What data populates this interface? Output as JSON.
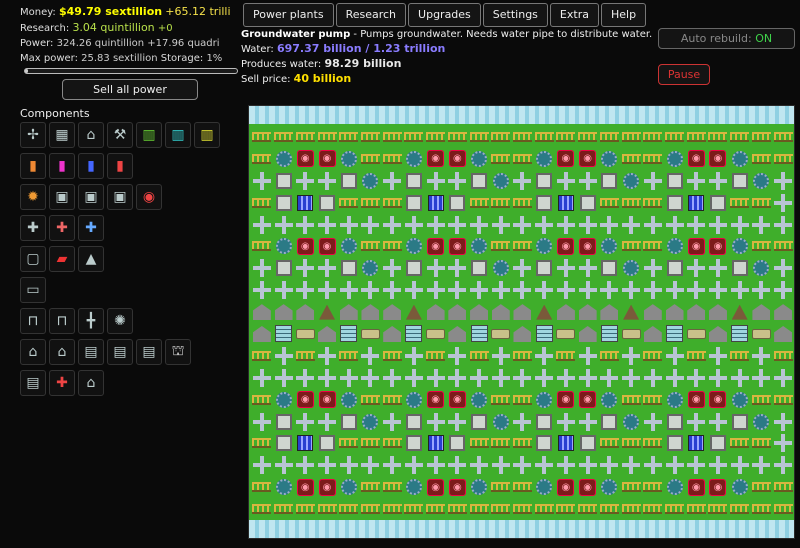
{
  "stats": {
    "money_label": "Money:",
    "money_value": "$49.79 sextillion",
    "money_rate": "+65.12 trilli",
    "research_label": "Research:",
    "research_value": "3.04 quintillion",
    "research_rate": "+0",
    "power_label": "Power:",
    "power_value": "324.26 quintillion",
    "power_rate": "+17.96 quadri",
    "maxpower_label": "Max power:",
    "maxpower_value": "25.83 sextillion",
    "storage_label": "Storage:",
    "storage_value": "1%",
    "power_fraction": 0.013
  },
  "sell_all_label": "Sell all power",
  "nav": [
    "Power plants",
    "Research",
    "Upgrades",
    "Settings",
    "Extra",
    "Help"
  ],
  "info": {
    "title": "Groundwater pump",
    "description": " - Pumps groundwater. Needs water pipe to distribute water.",
    "water_label": "Water: ",
    "water_value": "697.37 billion / 1.23 trillion",
    "produces_label": "Produces water: ",
    "produces_value": "98.29 billion",
    "sell_label": "Sell price: ",
    "sell_value": "40 billion"
  },
  "auto_rebuild_label": "Auto rebuild:",
  "auto_rebuild_value": "ON",
  "pause_label": "Pause",
  "components_title": "Components",
  "palette": [
    [
      "wind-turbine-icon",
      "solar-panel-icon",
      "coal-plant-icon",
      "oil-derrick-icon",
      "generator-green-icon",
      "generator-cyan-icon",
      "generator-yellow-icon"
    ],
    [
      "reactor-orange-icon",
      "reactor-pink-icon",
      "reactor-blue-icon",
      "reactor-red-icon"
    ],
    [
      "gear-orange-icon",
      "heat-exchanger-icon",
      "heat-exchanger-green-icon",
      "heat-exchanger-white-icon",
      "groundwater-pump-icon"
    ],
    [
      "pipe-icon",
      "pipe-red-icon",
      "pipe-blue-icon"
    ],
    [
      "tank-icon",
      "battery-icon",
      "tent-icon"
    ],
    [
      "bench-icon"
    ],
    [
      "fence-icon",
      "fence-yellow-icon",
      "cross-pipe-icon",
      "gear-icon"
    ],
    [
      "shop-icon",
      "house-icon",
      "apartment-icon",
      "office-icon",
      "office-tall-icon",
      "bank-icon"
    ],
    [
      "school-icon",
      "hospital-icon",
      "factory-icon"
    ]
  ],
  "grid_rows": [
    "FFFFFFFFFFFFFFFFFFFFFFFFF",
    "FGPPGFFGPPGFFGPPGFFGPPGFF",
    "XSXXSGXSXXSGXSXXSGXSXXSGX",
    "FSBSFFFSBSFFFSBSFFFSBSFFX",
    "XXXXXXXXXXXXXXXXXXXXXXXXX",
    "FGPPGFFGPPGFFGPPGFFGPPGFF",
    "XSXXSGXSXXSGXSXXSGXSXXSGX",
    "XXXXXXXXXXXXXXXXXXXXXXXXX",
    "HHHTHHHTHHHHHTHHHTHHHHTHH",
    "HONHONHONHONHONHONHONHONH",
    "FXFXFXFXFXFXFXFXFXFXFXFXF",
    "XXXXXXXXXXXXXXXXXXXXXXXXX",
    "FGPPGFFGPPGFFGPPGFFGPPGFF",
    "XSXXSGXSXXSGXSXXSGXSXXSGX",
    "FSBSFFFSBSFFFSBSFFFSBSFFX",
    "XXXXXXXXXXXXXXXXXXXXXXXXX",
    "FGPPGFFGPPGFFGPPGFFGPPGFF",
    "FFFFFFFFFFFFFFFFFFFFFFFFF"
  ],
  "tile_legend": {
    "F": "fence-tile",
    "G": "gear-tile",
    "P": "groundwater-pump-tile",
    "X": "pipe-cross-tile",
    "S": "steam-tile",
    "B": "blue-reactor-tile",
    "H": "house-tile",
    "T": "tent-tile",
    "O": "office-tile",
    "N": "bench-tile"
  },
  "colors": {
    "money": "#f5e24a",
    "water": "#8a7cff",
    "on": "#3fd24a",
    "pause": "#dd3333",
    "grass": "#3fae2b"
  }
}
